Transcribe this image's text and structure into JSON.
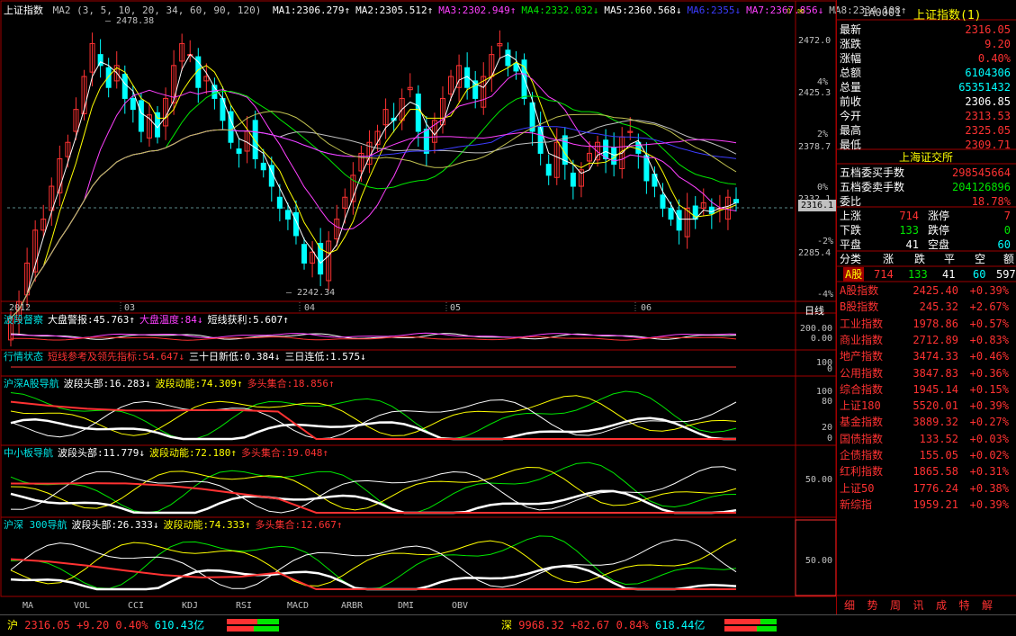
{
  "main_panel": {
    "title": "上证指数",
    "ma2_label": "MA2 (3, 5, 10, 20, 34, 60, 90, 120)",
    "ma_readouts": [
      {
        "text": "MA1:2306.279↑",
        "color": "#ffffff"
      },
      {
        "text": "MA2:2305.512↑",
        "color": "#ffffff"
      },
      {
        "text": "MA3:2302.949↑",
        "color": "#ff40ff"
      },
      {
        "text": "MA4:2332.032↓",
        "color": "#00e600"
      },
      {
        "text": "MA5:2360.568↓",
        "color": "#ffffff"
      },
      {
        "text": "MA6:2355↓",
        "color": "#3c3cff"
      },
      {
        "text": "MA7:2367.856↓",
        "color": "#ff40ff"
      },
      {
        "text": "MA8:2334.108↑",
        "color": "#c0c0c0"
      }
    ],
    "corner_arrows": "⇧ ✉",
    "high_label": "2478.38",
    "low_label": "2242.34",
    "price_axis": [
      "2472.0",
      "2425.3",
      "2378.7",
      "2332.1",
      "2285.4"
    ],
    "pct_axis": [
      "4%",
      "2%",
      "0%",
      "-2%",
      "-4%"
    ],
    "current_price_tag": "2316.1",
    "x_axis": [
      "2012",
      "03",
      "04",
      "05",
      "06"
    ],
    "period": "日线"
  },
  "indicators": [
    {
      "name": "波段督察",
      "items": [
        {
          "text": "大盘警报:45.763↑",
          "color": "#ffffff"
        },
        {
          "text": "大盘温度:84↓",
          "color": "#ff40ff"
        },
        {
          "text": "短线获利:5.607↑",
          "color": "#ffffff"
        }
      ],
      "axis": [
        "200.00",
        "0.00"
      ]
    },
    {
      "name": "行情状态",
      "items": [
        {
          "text": "短线参考及领先指标:54.647↓",
          "color": "#ff3232"
        },
        {
          "text": "三十日新低:0.384↓",
          "color": "#ffffff"
        },
        {
          "text": "三日连低:1.575↓",
          "color": "#ffffff"
        }
      ],
      "axis": [
        "100",
        "0"
      ]
    },
    {
      "name": "沪深A股导航",
      "items": [
        {
          "text": "波段头部:16.283↓",
          "color": "#ffffff"
        },
        {
          "text": "波段动能:74.309↑",
          "color": "#ffff00"
        },
        {
          "text": "多头集合:18.856↑",
          "color": "#ff3232"
        }
      ],
      "axis": [
        "100",
        "80",
        "20",
        "0"
      ]
    },
    {
      "name": "中小板导航",
      "items": [
        {
          "text": "波段头部:11.779↓",
          "color": "#ffffff"
        },
        {
          "text": "波段动能:72.180↑",
          "color": "#ffff00"
        },
        {
          "text": "多头集合:19.048↑",
          "color": "#ff3232"
        }
      ],
      "axis": [
        "50.00"
      ]
    },
    {
      "name": "沪深 300导航",
      "items": [
        {
          "text": "波段头部:26.333↓",
          "color": "#ffffff"
        },
        {
          "text": "波段动能:74.333↑",
          "color": "#ffff00"
        },
        {
          "text": "多头集合:12.667↑",
          "color": "#ff3232"
        }
      ],
      "axis": [
        "50.00"
      ]
    }
  ],
  "bottom_tabs": [
    "MA",
    "VOL",
    "CCI",
    "KDJ",
    "RSI",
    "MACD",
    "ARBR",
    "DMI",
    "OBV"
  ],
  "right_panel": {
    "code": "1A0001",
    "name": "上证指数(1)",
    "quote": [
      {
        "label": "最新",
        "value": "2316.05",
        "color": "#ff3232"
      },
      {
        "label": "涨跌",
        "value": "9.20",
        "color": "#ff3232"
      },
      {
        "label": "涨幅",
        "value": "0.40%",
        "color": "#ff3232"
      },
      {
        "label": "总额",
        "value": "6104306",
        "color": "#00ffff"
      },
      {
        "label": "总量",
        "value": "65351432",
        "color": "#00ffff"
      },
      {
        "label": "前收",
        "value": "2306.85",
        "color": "#ffffff"
      },
      {
        "label": "今开",
        "value": "2313.53",
        "color": "#ff3232"
      },
      {
        "label": "最高",
        "value": "2325.05",
        "color": "#ff3232"
      },
      {
        "label": "最低",
        "value": "2309.71",
        "color": "#ff3232"
      }
    ],
    "exchange": "上海证交所",
    "orders": [
      {
        "label": "五档委买手数",
        "value": "298545664",
        "color": "#ff3232"
      },
      {
        "label": "五档委卖手数",
        "value": "204126896",
        "color": "#00e600"
      },
      {
        "label": "委比",
        "value": "18.78%",
        "color": "#ff3232"
      }
    ],
    "breadth": [
      {
        "l1": "上涨",
        "v1": "714",
        "c1": "#ff3232",
        "l2": "涨停",
        "v2": "7",
        "c2": "#ff3232"
      },
      {
        "l1": "下跌",
        "v1": "133",
        "c1": "#00e600",
        "l2": "跌停",
        "v2": "0",
        "c2": "#00e600"
      },
      {
        "l1": "平盘",
        "v1": "41",
        "c1": "#ffffff",
        "l2": "空盘",
        "v2": "60",
        "c2": "#00ffff"
      }
    ],
    "class_header": [
      "分类",
      "涨",
      "跌",
      "平",
      "空",
      "额"
    ],
    "class_row": {
      "name": "A股",
      "up": "714",
      "down": "133",
      "flat": "41",
      "empty": "60",
      "amount": "597"
    },
    "indices": [
      {
        "name": "A股指数",
        "price": "2425.40",
        "change": "+0.39%"
      },
      {
        "name": "B股指数",
        "price": "245.32",
        "change": "+2.67%"
      },
      {
        "name": "工业指数",
        "price": "1978.86",
        "change": "+0.57%"
      },
      {
        "name": "商业指数",
        "price": "2712.89",
        "change": "+0.83%"
      },
      {
        "name": "地产指数",
        "price": "3474.33",
        "change": "+0.46%"
      },
      {
        "name": "公用指数",
        "price": "3847.83",
        "change": "+0.36%"
      },
      {
        "name": "综合指数",
        "price": "1945.14",
        "change": "+0.15%"
      },
      {
        "name": "上证180",
        "price": "5520.01",
        "change": "+0.39%"
      },
      {
        "name": "基金指数",
        "price": "3889.32",
        "change": "+0.27%"
      },
      {
        "name": "国债指数",
        "price": "133.52",
        "change": "+0.03%"
      },
      {
        "name": "企债指数",
        "price": "155.05",
        "change": "+0.02%"
      },
      {
        "name": "红利指数",
        "price": "1865.58",
        "change": "+0.31%"
      },
      {
        "name": "上证50",
        "price": "1776.24",
        "change": "+0.38%"
      },
      {
        "name": "新综指",
        "price": "1959.21",
        "change": "+0.39%"
      }
    ],
    "tabs": [
      "细",
      "势",
      "周",
      "讯",
      "成",
      "特",
      "解"
    ]
  },
  "status_bar": {
    "sh_label": "沪",
    "sh_price": "2316.05",
    "sh_change": "+9.20",
    "sh_pct": "0.40%",
    "sh_amount": "610.43亿",
    "sz_label": "深",
    "sz_price": "9968.32",
    "sz_change": "+82.67",
    "sz_pct": "0.84%",
    "sz_amount": "618.44亿"
  },
  "chart_data": {
    "type": "candlestick",
    "title": "上证指数",
    "y_range": [
      2242.34,
      2478.38
    ],
    "high": 2478.38,
    "low": 2242.34,
    "last": 2316.05,
    "previous_close": 2306.85
  }
}
